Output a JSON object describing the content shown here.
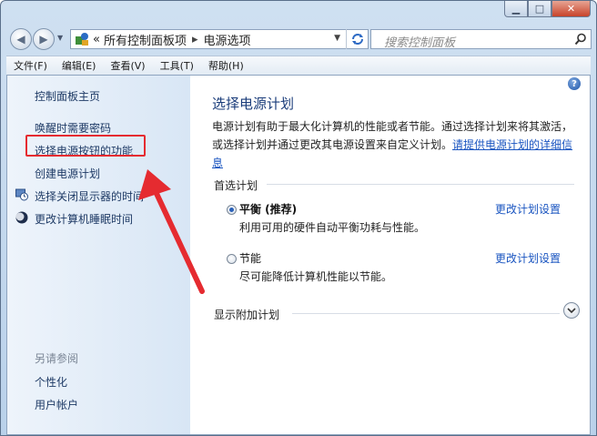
{
  "window": {
    "minimize_symbol": "▁",
    "maximize_symbol": "□",
    "close_symbol": "✕"
  },
  "nav": {
    "back_icon": "back-arrow-icon",
    "forward_icon": "forward-arrow-icon",
    "address": {
      "prefix": "«",
      "crumb1": "所有控制面板项",
      "sep": "▸",
      "crumb2": "电源选项"
    },
    "search_placeholder": "搜索控制面板"
  },
  "menu": [
    "文件(F)",
    "编辑(E)",
    "查看(V)",
    "工具(T)",
    "帮助(H)"
  ],
  "sidebar": {
    "home": "控制面板主页",
    "items": [
      {
        "label": "唤醒时需要密码"
      },
      {
        "label": "选择电源按钮的功能"
      },
      {
        "label": "创建电源计划"
      },
      {
        "label": "选择关闭显示器的时间",
        "icon": "monitor-clock-icon"
      },
      {
        "label": "更改计算机睡眠时间",
        "icon": "moon-icon"
      }
    ],
    "see_also": "另请参阅",
    "see_also_items": [
      "个性化",
      "用户帐户"
    ]
  },
  "main": {
    "title": "选择电源计划",
    "desc_text": "电源计划有助于最大化计算机的性能或者节能。通过选择计划来将其激活，或选择计划并通过更改其电源设置来自定义计划。",
    "desc_link": "请提供电源计划的详细信息",
    "preferred_label": "首选计划",
    "plans": [
      {
        "name": "平衡 (推荐)",
        "desc": "利用可用的硬件自动平衡功耗与性能。",
        "link": "更改计划设置",
        "selected": true
      },
      {
        "name": "节能",
        "desc": "尽可能降低计算机性能以节能。",
        "link": "更改计划设置",
        "selected": false
      }
    ],
    "more_label": "显示附加计划"
  },
  "colors": {
    "annotation_red": "#e52b30",
    "link_blue": "#1a55c0",
    "title_blue": "#1a3c7a"
  }
}
